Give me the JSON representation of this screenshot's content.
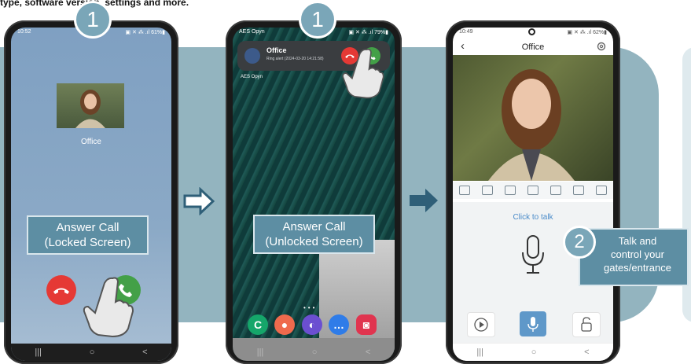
{
  "header": {
    "intro_text": "type, software version, settings and more."
  },
  "steps": {
    "step1": "1",
    "step2": "2"
  },
  "phone1": {
    "status_time": "10:52",
    "status_right": "▣ ✕ ⁂ .ıl 61%▮",
    "caller_name": "Office",
    "label_line1": "Answer Call",
    "label_line2": "(Locked Screen)"
  },
  "phone2": {
    "status_carrier": "AES Opyn",
    "status_right": "▣ ✕ ⁂ .ıl 79%▮",
    "notif_title": "Office",
    "notif_sub": "Ring alert (2024-03-20 14:21:58)",
    "home_label": "AES Opyn",
    "label_line1": "Answer Call",
    "label_line2": "(Unlocked Screen)"
  },
  "phone3": {
    "status_time": "10:49",
    "status_right": "▣ ✕ ⁂ .ıl 62%▮",
    "title": "Office",
    "click_to_talk": "Click to talk",
    "talk_line1": "Talk and",
    "talk_line2": "control your",
    "talk_line3": "gates/entrance"
  },
  "colors": {
    "accent": "#5d8ea3",
    "band": "#93b4bf",
    "decline": "#e53935",
    "accept": "#43a047",
    "talk": "#4a8bc9"
  },
  "icons": [
    "decline-phone-icon",
    "accept-phone-icon",
    "hand-pointer-icon",
    "arrow-right-icon",
    "microphone-icon",
    "settings-gear-icon",
    "back-chevron-icon",
    "playback-icon",
    "unlock-icon"
  ]
}
